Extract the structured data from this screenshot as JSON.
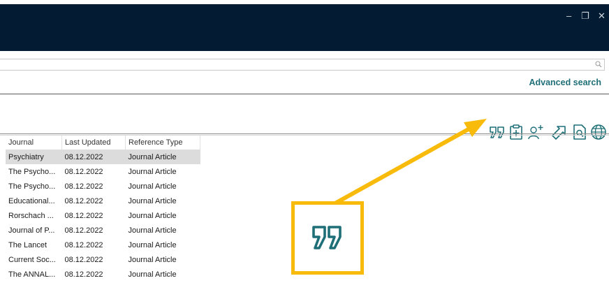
{
  "window": {
    "minimize_glyph": "–",
    "restore_glyph": "❐",
    "close_glyph": "✕"
  },
  "search": {
    "value": "",
    "placeholder": "",
    "advanced_label": "Advanced search"
  },
  "toolbar": {
    "icons": [
      "quote-icon",
      "clipboard-add-icon",
      "add-person-icon",
      "open-external-icon",
      "document-search-icon",
      "globe-icon"
    ],
    "accent_color": "#1f6f78"
  },
  "table": {
    "columns": [
      "Journal",
      "Last Updated",
      "Reference Type"
    ],
    "rows": [
      {
        "journal": "Psychiatry",
        "updated": "08.12.2022",
        "type": "Journal Article",
        "selected": true
      },
      {
        "journal": "The Psycho...",
        "updated": "08.12.2022",
        "type": "Journal Article"
      },
      {
        "journal": "The Psycho...",
        "updated": "08.12.2022",
        "type": "Journal Article"
      },
      {
        "journal": "Educational...",
        "updated": "08.12.2022",
        "type": "Journal Article"
      },
      {
        "journal": "Rorschach ...",
        "updated": "08.12.2022",
        "type": "Journal Article"
      },
      {
        "journal": "Journal of P...",
        "updated": "08.12.2022",
        "type": "Journal Article"
      },
      {
        "journal": "The Lancet",
        "updated": "08.12.2022",
        "type": "Journal Article"
      },
      {
        "journal": "Current Soc...",
        "updated": "08.12.2022",
        "type": "Journal Article"
      },
      {
        "journal": "The ANNAL...",
        "updated": "08.12.2022",
        "type": "Journal Article"
      }
    ]
  },
  "callout": {
    "color": "#f9bb0b",
    "icon": "quote-icon"
  },
  "colors": {
    "titlebar": "#031c33",
    "selected_row": "#dcdcdc"
  }
}
